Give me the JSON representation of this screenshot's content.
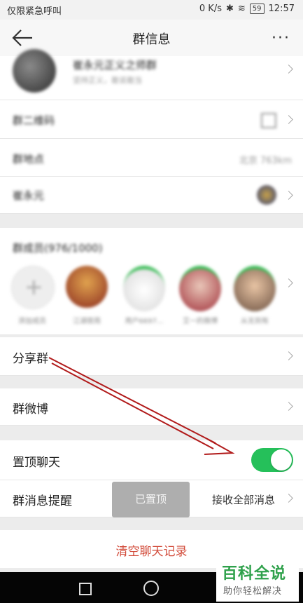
{
  "status_bar": {
    "left_text": "仅限紧急呼叫",
    "speed": "0 K/s",
    "battery": "59",
    "time": "12:57"
  },
  "header": {
    "title": "群信息",
    "back_icon": "arrow-left-icon",
    "more_icon": "more-dots-icon",
    "more_glyph": "···"
  },
  "group_top": {
    "name": "崔永元正义之师群",
    "desc": "坚持正义，敢说敢当"
  },
  "rows": {
    "qr_label": "群二维码",
    "location_label": "群地点",
    "location_value": "北京 763km",
    "owner_label": "崔永元"
  },
  "members": {
    "header": "群成员(976/1000)",
    "add_label": "添加成员",
    "names": [
      "江湖夜雨",
      "用户6697...",
      "艾一的微博",
      "从无到有"
    ]
  },
  "share": {
    "label": "分享群"
  },
  "weibo": {
    "label": "群微博"
  },
  "pin": {
    "label": "置顶聊天",
    "enabled": true
  },
  "notify": {
    "label": "群消息提醒",
    "value": "接收全部消息"
  },
  "toast": {
    "text": "已置顶"
  },
  "clear": {
    "label": "清空聊天记录"
  },
  "watermark": {
    "title": "百科全说",
    "subtitle": "助你轻松解决"
  },
  "colors": {
    "accent_green": "#25c05a",
    "danger": "#d24b3a",
    "arrow_red": "#b11a1a"
  }
}
